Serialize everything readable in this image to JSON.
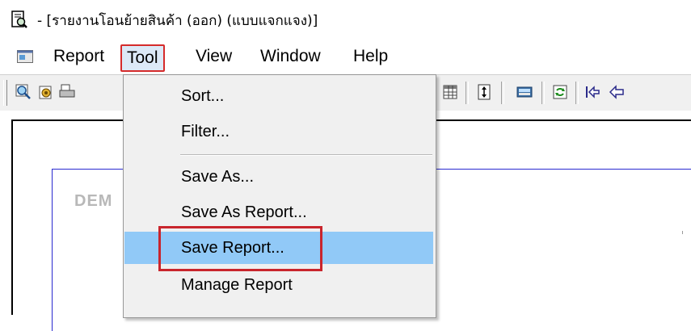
{
  "window": {
    "title": "- [รายงานโอนย้ายสินค้า (ออก) (แบบแจกแจง)]",
    "app_icon": "report-preview-icon"
  },
  "menubar": {
    "items": [
      {
        "label": "Report"
      },
      {
        "label": "Tool"
      },
      {
        "label": "View"
      },
      {
        "label": "Window"
      },
      {
        "label": "Help"
      }
    ],
    "active": "Tool"
  },
  "toolbar": {
    "buttons": [
      "zoom-icon",
      "setup-icon",
      "print-icon",
      "grid-icon",
      "fit-height-icon",
      "display-icon",
      "refresh-icon",
      "first-page-icon",
      "prev-page-icon"
    ]
  },
  "dropdown": {
    "items": [
      {
        "label": "Sort..."
      },
      {
        "label": "Filter..."
      },
      {
        "label": "Save As..."
      },
      {
        "label": "Save As Report..."
      },
      {
        "label": "Save Report..."
      },
      {
        "label": "Manage Report"
      }
    ],
    "selected": "Save Report..."
  },
  "document": {
    "watermark": "DEM"
  },
  "colors": {
    "highlight": "#91c9f7",
    "annotation_red": "#c9252d",
    "page_border": "#2a2ad0"
  }
}
